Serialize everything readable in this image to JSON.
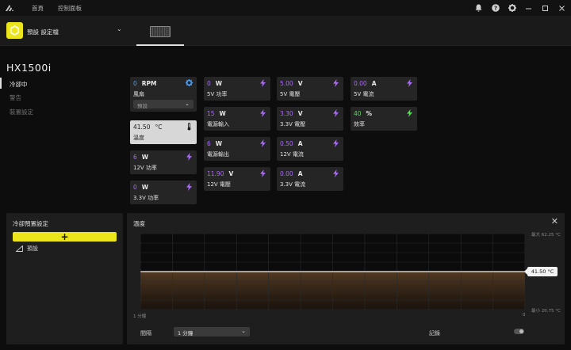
{
  "titlebar": {
    "nav": [
      "首頁",
      "控制面板"
    ],
    "icons": [
      "bell-icon",
      "help-icon",
      "gear-icon",
      "minimize-icon",
      "maximize-icon",
      "close-icon"
    ]
  },
  "device_bar": {
    "profile_name": "預設 設定檔",
    "accent": "#ece51b"
  },
  "device": {
    "title": "HX1500i",
    "nav": [
      {
        "label": "冷卻中",
        "active": true
      },
      {
        "label": "警告",
        "active": false
      },
      {
        "label": "裝置設定",
        "active": false
      }
    ]
  },
  "tiles": {
    "fan": {
      "value": "0",
      "unit": "RPM",
      "label": "風扇",
      "select": "預設"
    },
    "temp": {
      "value": "41.50",
      "unit": "°C",
      "label": "溫度"
    },
    "w12_power": {
      "value": "6",
      "unit": "W",
      "label": "12V 功率"
    },
    "w33_power": {
      "value": "0",
      "unit": "W",
      "label": "3.3V 功率"
    },
    "w5_power": {
      "value": "0",
      "unit": "W",
      "label": "5V 功率"
    },
    "power_in": {
      "value": "15",
      "unit": "W",
      "label": "電源輸入"
    },
    "power_out": {
      "value": "6",
      "unit": "W",
      "label": "電源輸出"
    },
    "v12_voltage": {
      "value": "11.90",
      "unit": "V",
      "label": "12V 電壓"
    },
    "v5_voltage": {
      "value": "5.00",
      "unit": "V",
      "label": "5V 電壓"
    },
    "v33_voltage": {
      "value": "3.30",
      "unit": "V",
      "label": "3.3V 電壓"
    },
    "a12_current": {
      "value": "0.50",
      "unit": "A",
      "label": "12V 電流"
    },
    "a33_current": {
      "value": "0.00",
      "unit": "A",
      "label": "3.3V 電流"
    },
    "a5_current": {
      "value": "0.00",
      "unit": "A",
      "label": "5V 電流"
    },
    "efficiency": {
      "value": "40",
      "unit": "%",
      "label": "效率"
    }
  },
  "preset_panel": {
    "title": "冷卻預置設定",
    "add_label": "+",
    "items": [
      "預設"
    ]
  },
  "graph": {
    "title": "溫度",
    "max_label": "最大 62.25 °C",
    "min_label": "最小 20.75 °C",
    "current_label": "41.50 °C",
    "x_left_label": "1 分鐘",
    "x_right_label": "0",
    "interval_label": "間隔",
    "interval_value": "1 分鐘",
    "record_label": "記錄",
    "record_on": false
  },
  "chart_data": {
    "type": "line",
    "x": [
      1,
      0
    ],
    "values": [
      41.5,
      41.5
    ],
    "ylim": [
      20.75,
      62.25
    ],
    "grid": true
  }
}
